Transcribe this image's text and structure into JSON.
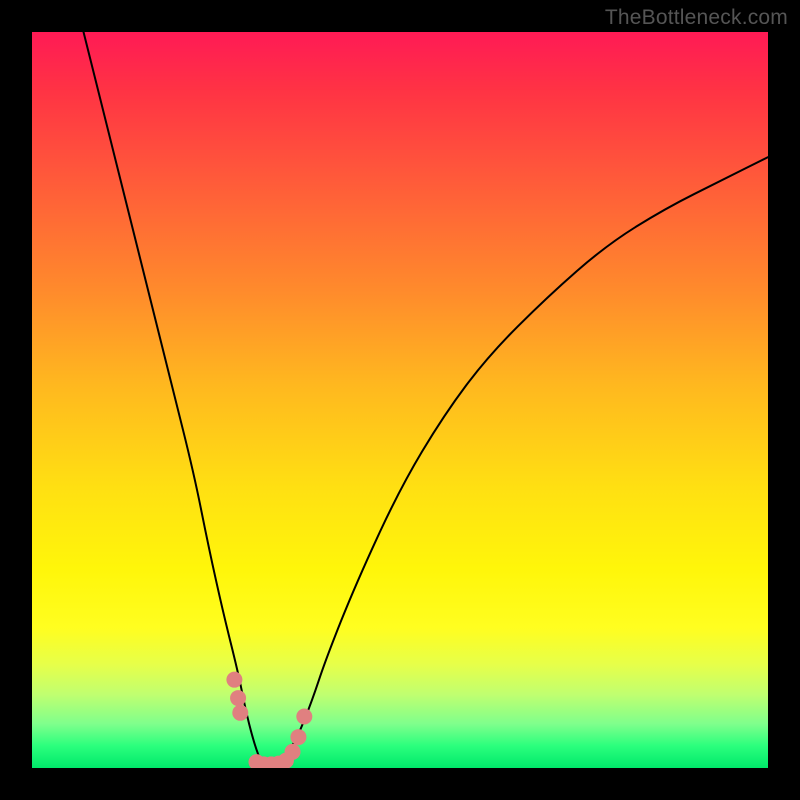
{
  "watermark": "TheBottleneck.com",
  "chart_data": {
    "type": "line",
    "title": "",
    "xlabel": "",
    "ylabel": "",
    "xlim": [
      0,
      100
    ],
    "ylim": [
      0,
      100
    ],
    "curve": {
      "x": [
        7,
        10,
        13,
        16,
        19,
        22,
        24,
        26,
        28,
        29,
        30,
        31,
        32,
        33,
        34,
        36,
        38,
        40,
        44,
        50,
        56,
        62,
        70,
        78,
        86,
        94,
        100
      ],
      "y": [
        100,
        88,
        76,
        64,
        52,
        40,
        30,
        21,
        13,
        8,
        4,
        1,
        0,
        0,
        1,
        4,
        9,
        15,
        25,
        38,
        48,
        56,
        64,
        71,
        76,
        80,
        83
      ]
    },
    "markers": {
      "x": [
        27.5,
        28.0,
        28.3,
        30.5,
        31.5,
        32.5,
        33.5,
        34.5,
        35.4,
        36.2,
        37.0
      ],
      "y": [
        12.0,
        9.5,
        7.5,
        0.8,
        0.5,
        0.5,
        0.6,
        1.0,
        2.2,
        4.2,
        7.0
      ],
      "color": "#e08080",
      "radius_px": 8
    },
    "curve_stroke_px": 2
  }
}
